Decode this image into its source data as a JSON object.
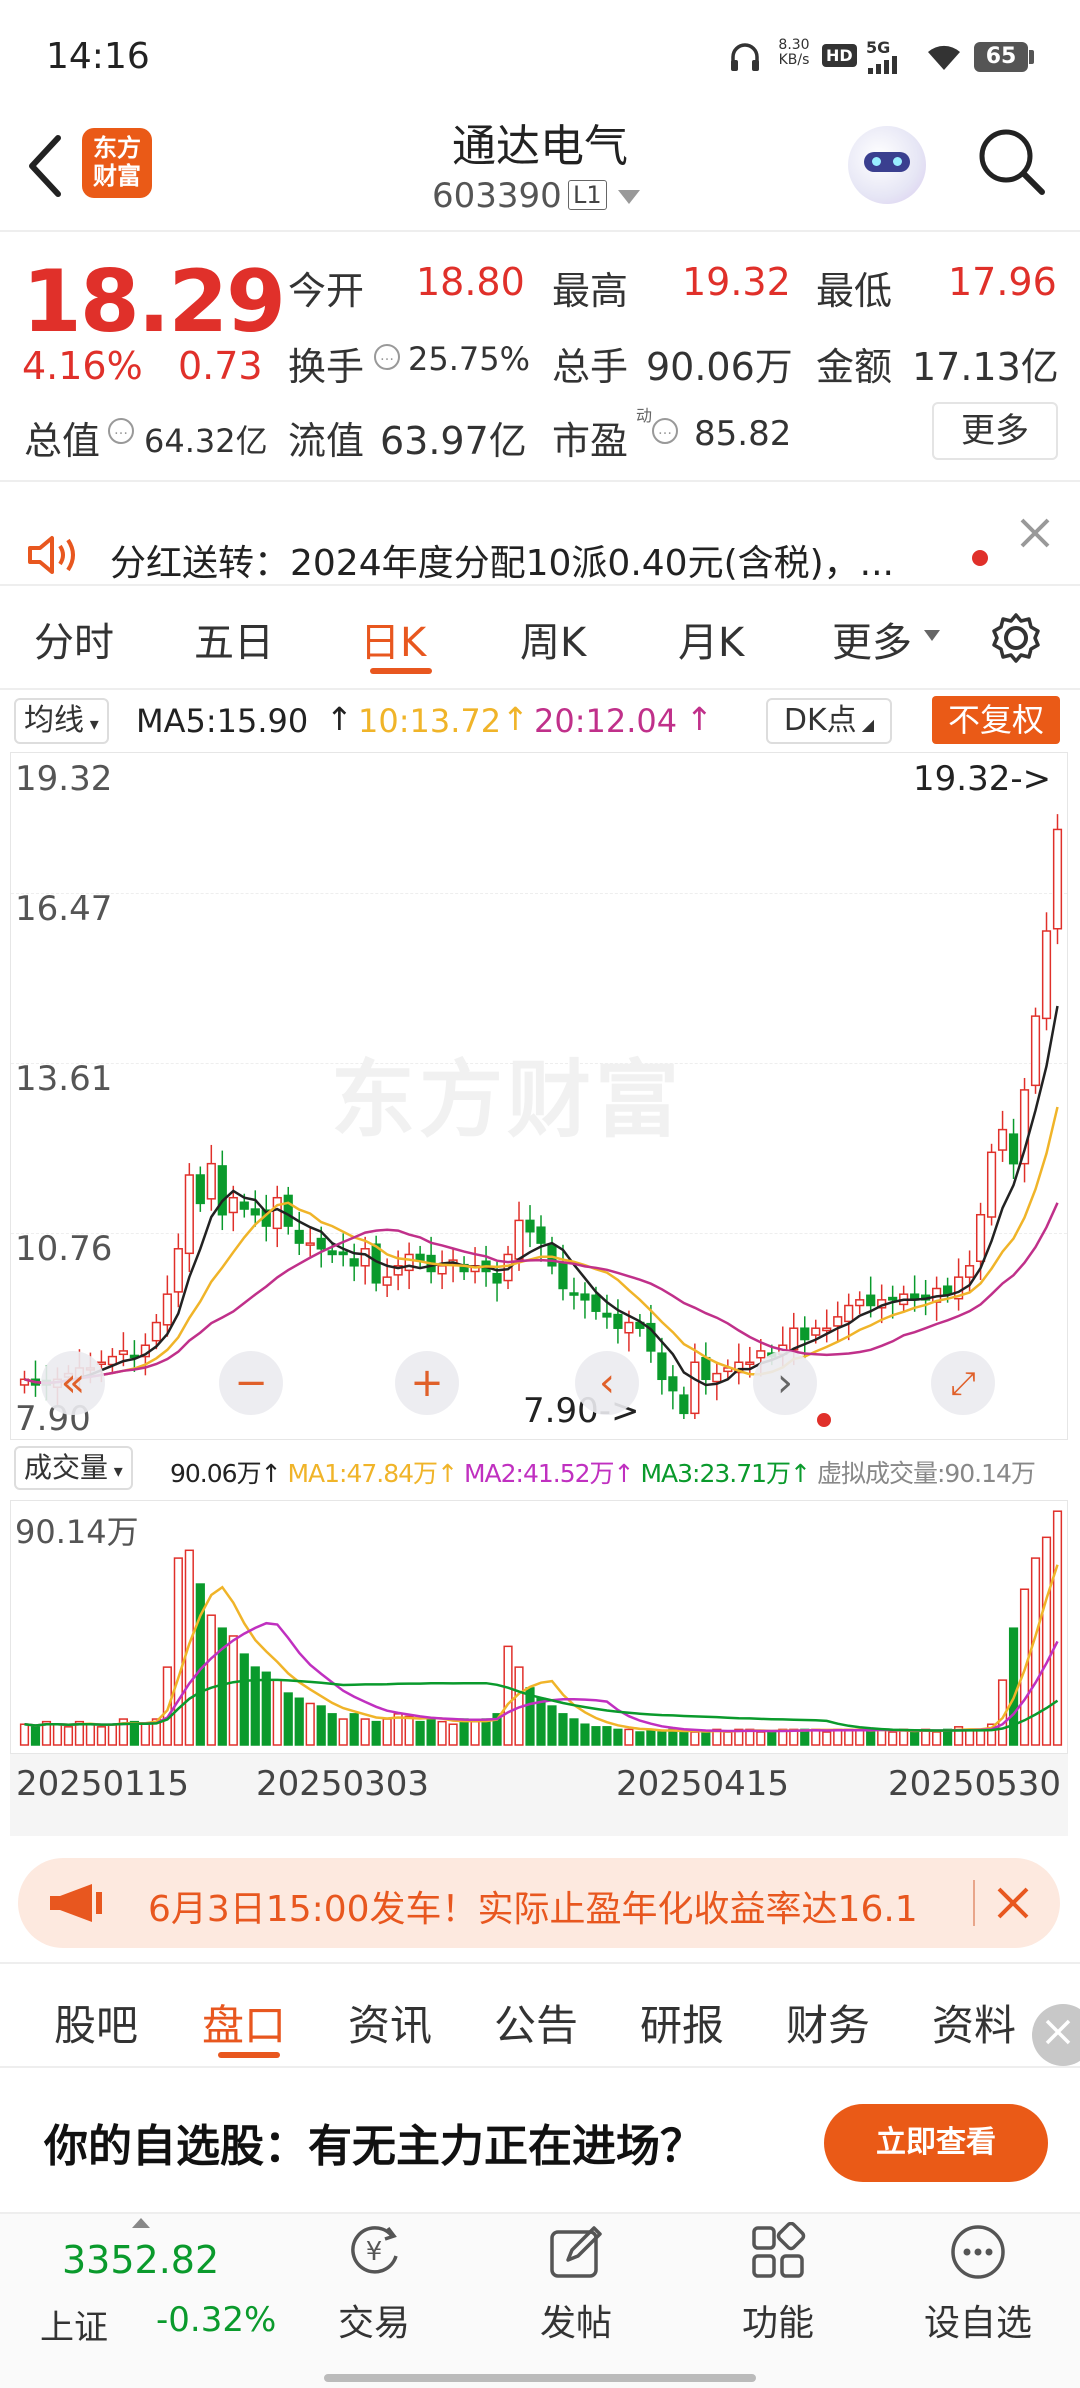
{
  "status_bar": {
    "time": "14:16",
    "net_speed_top": "8.30",
    "net_speed_unit": "KB/s",
    "hd": "HD",
    "signal": "5G",
    "battery": "65"
  },
  "header": {
    "logo_line1": "东方",
    "logo_line2": "财富",
    "title": "通达电气",
    "code": "603390",
    "level": "L1"
  },
  "quote": {
    "price": "18.29",
    "change_pct": "4.16%",
    "change": "0.73",
    "open_label": "今开",
    "open": "18.80",
    "high_label": "最高",
    "high": "19.32",
    "low_label": "最低",
    "low": "17.96",
    "turnover_label": "换手",
    "turnover": "25.75%",
    "volume_label": "总手",
    "volume": "90.06万",
    "amount_label": "金额",
    "amount": "17.13亿",
    "mcap_label": "总值",
    "mcap": "64.32亿",
    "float_label": "流值",
    "float": "63.97亿",
    "pe_label": "市盈",
    "pe_sup": "动",
    "pe": "85.82",
    "more": "更多"
  },
  "notice": {
    "text": "分红送转：2024年度分配10派0.40元(含税)，..."
  },
  "chart_tabs": [
    "分时",
    "五日",
    "日K",
    "周K",
    "月K",
    "更多"
  ],
  "active_chart_tab": "日K",
  "ma_bar": {
    "label": "均线",
    "ma5": "MA5:15.90",
    "ma10": "10:13.72",
    "ma20": "20:12.04",
    "dk": "DK点",
    "adjust": "不复权"
  },
  "price_axis": [
    "19.32",
    "16.47",
    "13.61",
    "10.76",
    "7.90"
  ],
  "watermark": "东方财富",
  "annotations": {
    "max": "19.32->",
    "min": "7.90->"
  },
  "vol_bar": {
    "label": "成交量",
    "vol": "90.06万",
    "ma1": "MA1:47.84万",
    "ma2": "MA2:41.52万",
    "ma3": "MA3:23.71万",
    "virtual": "虚拟成交量:90.14万",
    "axis_max": "90.14万"
  },
  "dates": [
    "20250115",
    "20250303",
    "20250415",
    "20250530"
  ],
  "colors": {
    "up": "#e0302a",
    "down": "#0a9a2c",
    "ma5": "#222222",
    "ma10": "#f0b429",
    "ma20": "#c0308a",
    "accent": "#e8571f"
  },
  "chart_data": [
    {
      "type": "candlestick",
      "ylim": [
        7.9,
        19.32
      ],
      "closes": [
        8.6,
        8.5,
        8.5,
        8.6,
        8.7,
        8.8,
        8.8,
        8.9,
        9.0,
        9.1,
        9.0,
        9.2,
        9.6,
        10.1,
        10.9,
        12.2,
        11.7,
        12.4,
        11.5,
        11.8,
        11.6,
        11.5,
        11.3,
        11.8,
        11.3,
        11.0,
        11.0,
        10.9,
        10.8,
        10.8,
        10.6,
        10.9,
        10.3,
        10.4,
        10.6,
        10.8,
        10.7,
        10.5,
        10.6,
        10.7,
        10.5,
        10.6,
        10.5,
        10.3,
        10.8,
        11.4,
        11.2,
        11.0,
        10.6,
        10.2,
        10.1,
        10.0,
        9.8,
        9.7,
        9.5,
        9.6,
        9.5,
        9.1,
        8.6,
        8.4,
        8.0,
        8.9,
        8.6,
        8.7,
        8.8,
        8.9,
        8.9,
        9.1,
        9.0,
        9.2,
        9.5,
        9.3,
        9.5,
        9.5,
        9.7,
        9.9,
        10.0,
        9.9,
        10.0,
        10.0,
        10.1,
        10.0,
        10.0,
        10.2,
        10.1,
        10.4,
        10.6,
        11.5,
        12.6,
        13.0,
        12.4,
        13.7,
        15.0,
        16.5,
        18.29
      ],
      "ma5_last": 15.9,
      "ma10_last": 13.72,
      "ma20_last": 12.04,
      "max": 19.32,
      "min": 7.9
    },
    {
      "type": "bar",
      "title": "成交量",
      "ylim": [
        0,
        90.14
      ],
      "values": [
        8,
        7,
        9,
        8,
        7,
        9,
        8,
        7,
        8,
        10,
        9,
        8,
        10,
        30,
        72,
        75,
        62,
        50,
        45,
        42,
        35,
        30,
        28,
        25,
        20,
        18,
        16,
        15,
        12,
        10,
        12,
        10,
        9,
        10,
        12,
        11,
        9,
        10,
        9,
        8,
        10,
        9,
        10,
        12,
        38,
        30,
        22,
        18,
        15,
        12,
        10,
        8,
        7,
        7,
        6,
        6,
        5,
        6,
        5,
        6,
        5,
        5,
        5,
        6,
        5,
        6,
        6,
        5,
        5,
        6,
        6,
        6,
        6,
        5,
        6,
        6,
        6,
        5,
        6,
        5,
        6,
        5,
        6,
        5,
        6,
        7,
        6,
        6,
        8,
        25,
        45,
        60,
        72,
        80,
        90.06
      ]
    }
  ],
  "promo": {
    "text": "6月3日15:00发车！实际止盈年化收益率达16.1"
  },
  "bottom_tabs": [
    "股吧",
    "盘口",
    "资讯",
    "公告",
    "研报",
    "财务",
    "资料"
  ],
  "active_bottom_tab": "盘口",
  "banner": {
    "text": "你的自选股：有无主力正在进场？",
    "button": "立即查看"
  },
  "index": {
    "value": "3352.82",
    "name": "上证",
    "change": "-0.32%"
  },
  "nav": [
    "交易",
    "发帖",
    "功能",
    "设自选"
  ]
}
